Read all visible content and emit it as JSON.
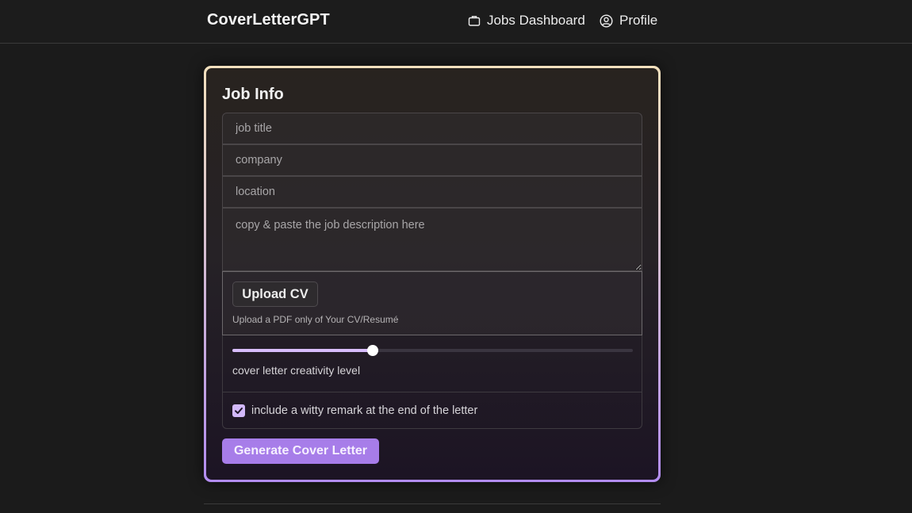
{
  "header": {
    "brand": "CoverLetterGPT",
    "nav": {
      "jobs_label": "Jobs Dashboard",
      "jobs_icon": "briefcase-icon",
      "profile_label": "Profile",
      "profile_icon": "user-circle-icon"
    }
  },
  "form": {
    "title": "Job Info",
    "fields": {
      "job_title_placeholder": "job title",
      "company_placeholder": "company",
      "location_placeholder": "location",
      "description_placeholder": "copy & paste the job description here"
    },
    "upload": {
      "button_label": "Upload CV",
      "hint": "Upload a PDF only of Your CV/Resumé"
    },
    "creativity": {
      "label": "cover letter creativity level",
      "value": 0.35
    },
    "witty": {
      "label": "include a witty remark at the end of the letter",
      "checked": true
    },
    "submit_label": "Generate Cover Letter"
  },
  "colors": {
    "accent": "#a77de9",
    "accent_light": "#d8bdfd",
    "border_gradient_top": "#f2e0bd",
    "border_gradient_bottom": "#b28cf0",
    "background": "#1b1b1b"
  }
}
